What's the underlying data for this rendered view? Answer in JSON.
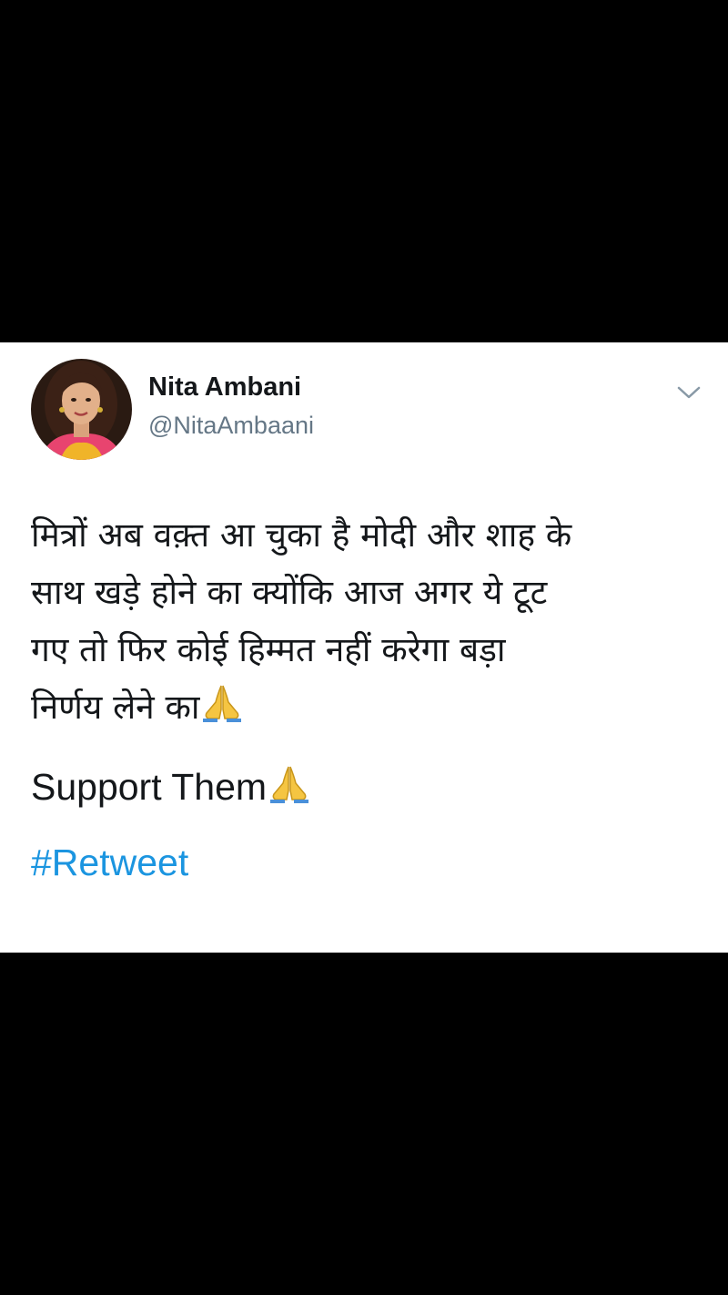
{
  "tweet": {
    "author": {
      "name": "Nita Ambani",
      "handle": "@NitaAmbaani",
      "avatar_icon": "profile-photo"
    },
    "menu_icon": "chevron-down-icon",
    "text_lines": [
      "मित्रों अब वक़्त आ चुका है मोदी और शाह के",
      "साथ खड़े होने का क्योंकि आज अगर ये टूट",
      "गए तो फिर कोई हिम्मत नहीं करेगा बड़ा",
      "निर्णय लेने का"
    ],
    "emoji_icon": "folded-hands-emoji",
    "support_text": "Support Them",
    "hashtag": "#Retweet",
    "colors": {
      "hashtag": "#1b95e0",
      "handle": "#657786",
      "background": "#000000",
      "card": "#ffffff"
    }
  }
}
